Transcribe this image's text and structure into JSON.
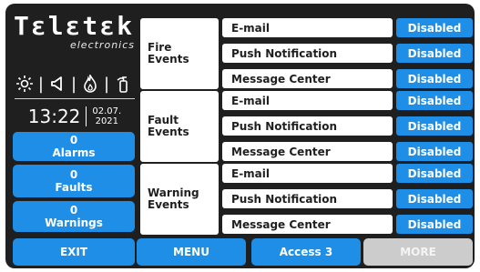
{
  "logo": {
    "brand": "Tεlεtεk",
    "sub": "electronics"
  },
  "status_icons": [
    "sun-icon",
    "speaker-icon",
    "flame-icon",
    "extinguisher-icon"
  ],
  "clock": {
    "time": "13:22",
    "date_line1": "02.07.",
    "date_line2": "2021"
  },
  "status": {
    "alarms": {
      "count": "0",
      "label": "Alarms"
    },
    "faults": {
      "count": "0",
      "label": "Faults"
    },
    "warnings": {
      "count": "0",
      "label": "Warnings"
    }
  },
  "groups": [
    {
      "label": "Fire\nEvents",
      "channels": [
        {
          "name": "E-mail",
          "state": "Disabled"
        },
        {
          "name": "Push Notification",
          "state": "Disabled"
        },
        {
          "name": "Message Center",
          "state": "Disabled"
        }
      ]
    },
    {
      "label": "Fault\nEvents",
      "channels": [
        {
          "name": "E-mail",
          "state": "Disabled"
        },
        {
          "name": "Push Notification",
          "state": "Disabled"
        },
        {
          "name": "Message Center",
          "state": "Disabled"
        }
      ]
    },
    {
      "label": "Warning\nEvents",
      "channels": [
        {
          "name": "E-mail",
          "state": "Disabled"
        },
        {
          "name": "Push Notification",
          "state": "Disabled"
        },
        {
          "name": "Message Center",
          "state": "Disabled"
        }
      ]
    }
  ],
  "bottom_bar": {
    "exit": "EXIT",
    "menu": "MENU",
    "access": "Access 3",
    "more": "MORE"
  },
  "colors": {
    "accent": "#1f8ee6",
    "background": "#1f1f1f",
    "disabled": "#cccccc"
  }
}
